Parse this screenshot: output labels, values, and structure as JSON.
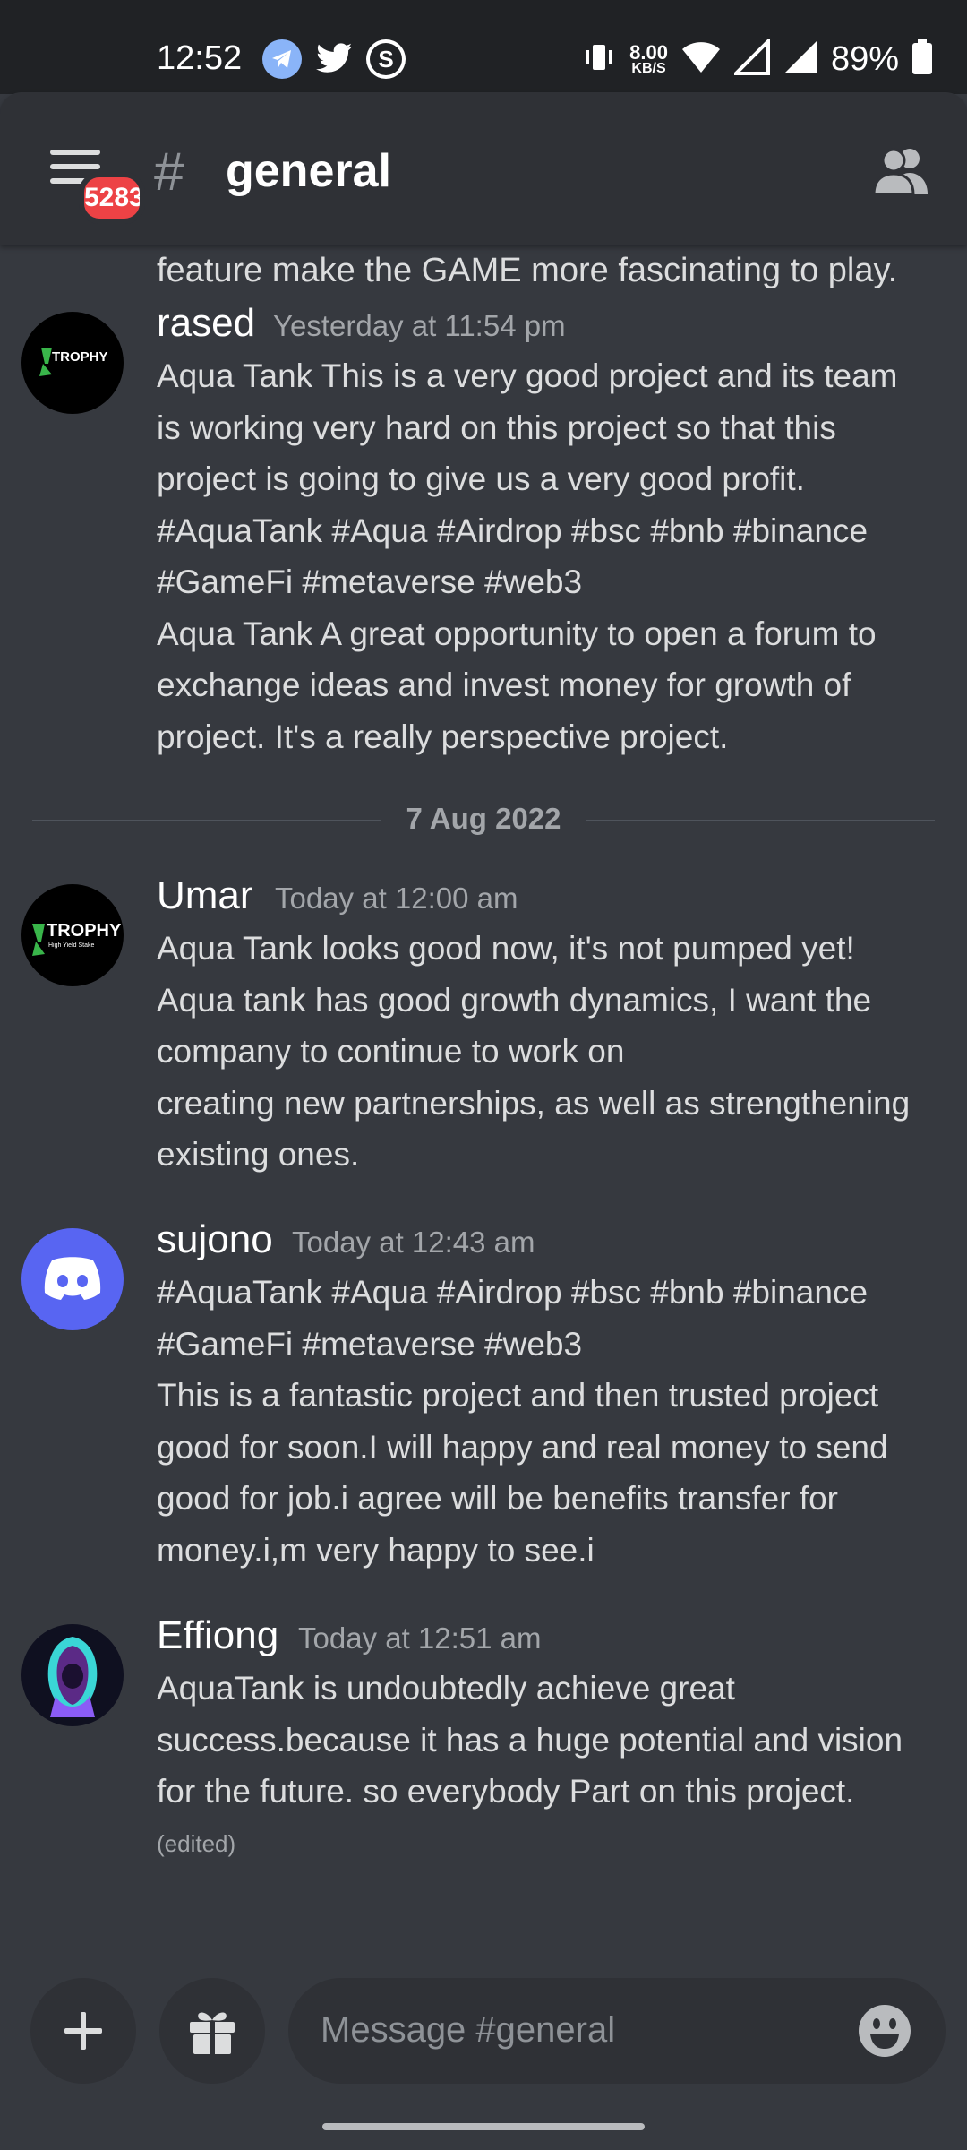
{
  "status_bar": {
    "time": "12:52",
    "speed": "8.00",
    "speed_unit": "KB/S",
    "battery": "89%",
    "apps": [
      "telegram-icon",
      "twitter-icon",
      "s-app-icon"
    ]
  },
  "header": {
    "hash": "#",
    "channel": "general",
    "badge": "5283"
  },
  "messages": {
    "tail": "feature make the GAME more fascinating to play.",
    "divider": "7 Aug 2022",
    "items": [
      {
        "user": "rased",
        "time": "Yesterday at 11:54 pm",
        "avatar_text": "TROPHY",
        "lines": [
          "Aqua Tank This is a very good project and its team",
          "is working very hard on this project so that this",
          "project is going to give us a very good profit.",
          "#AquaTank #Aqua #Airdrop #bsc #bnb #binance",
          "#GameFi #metaverse #web3",
          "Aqua Tank A great opportunity to open a forum to",
          "exchange ideas and invest money for growth of",
          "project. It's a really perspective project."
        ]
      },
      {
        "user": "Umar",
        "time": "Today at 12:00 am",
        "avatar_text": "TROPHY",
        "avatar_sub": "High Yield Stake",
        "lines": [
          "Aqua Tank looks good now, it's not pumped yet!",
          "Aqua tank has good growth dynamics, I want the",
          "company to continue to work on",
          "creating new partnerships, as well as strengthening",
          "existing ones."
        ]
      },
      {
        "user": "sujono",
        "time": "Today at 12:43 am",
        "lines": [
          "#AquaTank #Aqua #Airdrop #bsc #bnb #binance",
          "#GameFi #metaverse #web3",
          "This is a fantastic project and then trusted project",
          "good for soon.I will happy and real money to send",
          "good for job.i agree will be benefits transfer for",
          "money.i,m very happy to see.i"
        ]
      },
      {
        "user": "Effiong",
        "time": "Today at 12:51 am",
        "lines": [
          "AquaTank is undoubtedly achieve great",
          "success.because it has a huge potential and vision",
          "for the future. so everybody Part on this project."
        ],
        "edited": "(edited)"
      }
    ]
  },
  "composer": {
    "placeholder": "Message #general"
  },
  "colors": {
    "background": "#36393f",
    "header": "#2f3136",
    "badge": "#ed4245",
    "discord_blurple": "#5865f2"
  }
}
